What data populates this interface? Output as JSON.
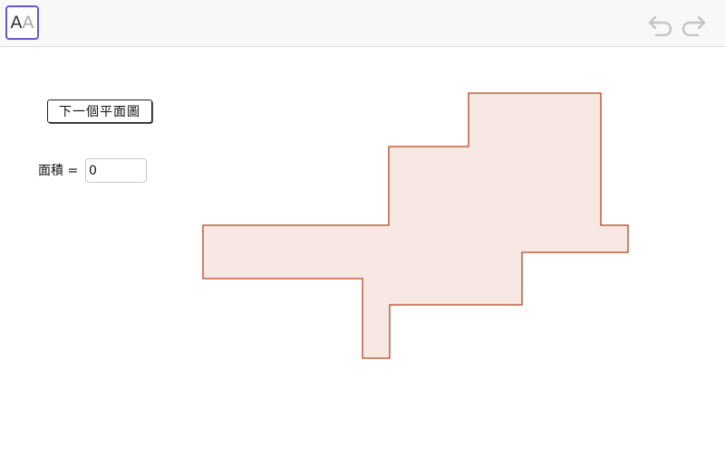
{
  "toolbar": {
    "style_button": {
      "letter_dark": "A",
      "letter_light": "A",
      "icon": "text-style-icon"
    },
    "undo_icon": "undo-icon",
    "redo_icon": "redo-icon"
  },
  "controls": {
    "next_button_label": "下一個平面圖",
    "area_label": "面積 =",
    "area_value": "0"
  },
  "colors": {
    "accent": "#6557d2",
    "shape_fill": "#f7e8e4",
    "shape_stroke": "#b5451b",
    "toolbar_bg": "#f8f8f8"
  }
}
